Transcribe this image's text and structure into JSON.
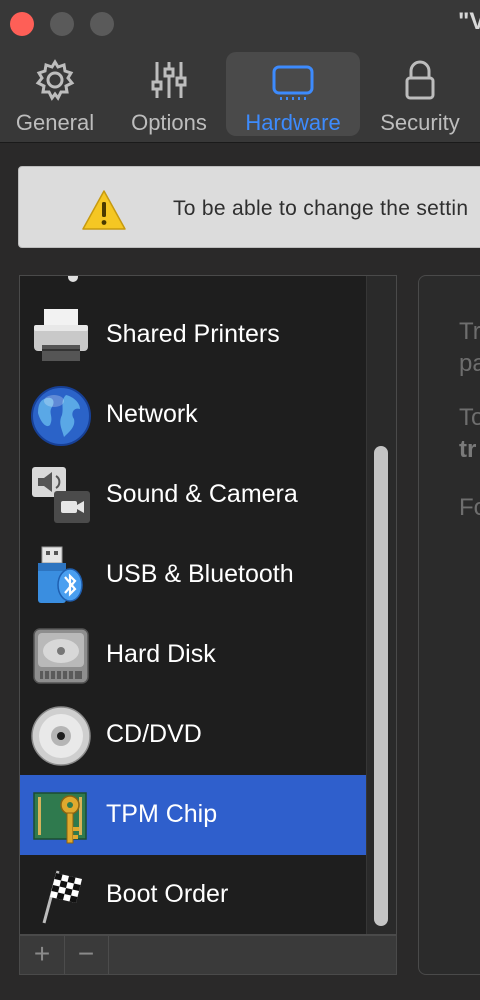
{
  "window": {
    "title": "\"V"
  },
  "tabs": [
    {
      "label": "General",
      "icon": "gear-icon",
      "active": false
    },
    {
      "label": "Options",
      "icon": "sliders-icon",
      "active": false
    },
    {
      "label": "Hardware",
      "icon": "hardware-icon",
      "active": true
    },
    {
      "label": "Security",
      "icon": "lock-icon",
      "active": false
    }
  ],
  "banner": {
    "text": "To be able to change the settin",
    "icon": "warning-icon"
  },
  "device_list": {
    "items": [
      {
        "label": "Shared Printers",
        "icon": "printer-icon",
        "selected": false
      },
      {
        "label": "Network",
        "icon": "globe-icon",
        "selected": false
      },
      {
        "label": "Sound & Camera",
        "icon": "sound-camera-icon",
        "selected": false
      },
      {
        "label": "USB & Bluetooth",
        "icon": "usb-bluetooth-icon",
        "selected": false
      },
      {
        "label": "Hard Disk",
        "icon": "hard-disk-icon",
        "selected": false
      },
      {
        "label": "CD/DVD",
        "icon": "cd-dvd-icon",
        "selected": false
      },
      {
        "label": "TPM Chip",
        "icon": "tpm-chip-icon",
        "selected": true
      },
      {
        "label": "Boot Order",
        "icon": "checkered-flag-icon",
        "selected": false
      }
    ],
    "add_label": "+",
    "remove_label": "−"
  },
  "detail_panel": {
    "lines": [
      {
        "text": "Tr",
        "bold": false
      },
      {
        "text": "pa",
        "bold": false
      },
      {
        "text": "To",
        "bold": false
      },
      {
        "text": "tr",
        "bold": true
      },
      {
        "text": "Fo",
        "bold": false
      }
    ]
  },
  "colors": {
    "accent": "#3d8bfd",
    "selection": "#2f5fcc",
    "close": "#fe5f57"
  }
}
